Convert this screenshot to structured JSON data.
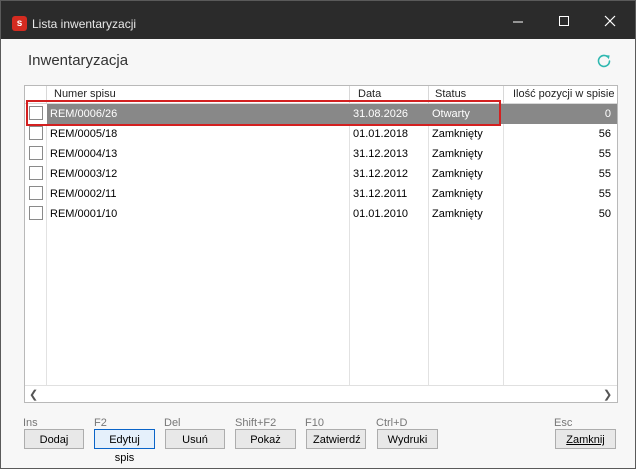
{
  "window": {
    "title": "Lista inwentaryzacji",
    "app_icon_letter": "s"
  },
  "page": {
    "title": "Inwentaryzacja"
  },
  "table": {
    "columns": [
      "Numer spisu",
      "Data",
      "Status",
      "Ilość pozycji w spisie"
    ],
    "rows": [
      {
        "numer": "REM/0006/26",
        "data": "31.08.2026",
        "status": "Otwarty",
        "ilosc": "0",
        "selected": true
      },
      {
        "numer": "REM/0005/18",
        "data": "01.01.2018",
        "status": "Zamknięty",
        "ilosc": "56"
      },
      {
        "numer": "REM/0004/13",
        "data": "31.12.2013",
        "status": "Zamknięty",
        "ilosc": "55"
      },
      {
        "numer": "REM/0003/12",
        "data": "31.12.2012",
        "status": "Zamknięty",
        "ilosc": "55"
      },
      {
        "numer": "REM/0002/11",
        "data": "31.12.2011",
        "status": "Zamknięty",
        "ilosc": "55"
      },
      {
        "numer": "REM/0001/10",
        "data": "01.01.2010",
        "status": "Zamknięty",
        "ilosc": "50"
      }
    ]
  },
  "buttons": {
    "dodaj": {
      "label": "Dodaj",
      "shortcut": "Ins"
    },
    "edytuj": {
      "label": "Edytuj spis",
      "shortcut": "F2"
    },
    "usun": {
      "label": "Usuń",
      "shortcut": "Del"
    },
    "pokaz": {
      "label": "Pokaż",
      "shortcut": "Shift+F2"
    },
    "zatwierdz": {
      "label": "Zatwierdź",
      "shortcut": "F10"
    },
    "wydruki": {
      "label": "Wydruki",
      "shortcut": "Ctrl+D"
    },
    "zamknij": {
      "label": "Zamknij",
      "shortcut": "Esc"
    }
  },
  "colors": {
    "titlebar": "#2b2b2b",
    "selected_row": "#888888",
    "highlight_outline": "#d32020",
    "refresh_accent": "#2fb8b0",
    "focus_border": "#0a64c8"
  },
  "icons": {
    "app": "app-logo-icon",
    "minimize": "minimize-icon",
    "maximize": "maximize-icon",
    "close": "close-icon",
    "refresh": "refresh-icon",
    "scroll_left": "chevron-left-icon",
    "scroll_right": "chevron-right-icon"
  }
}
